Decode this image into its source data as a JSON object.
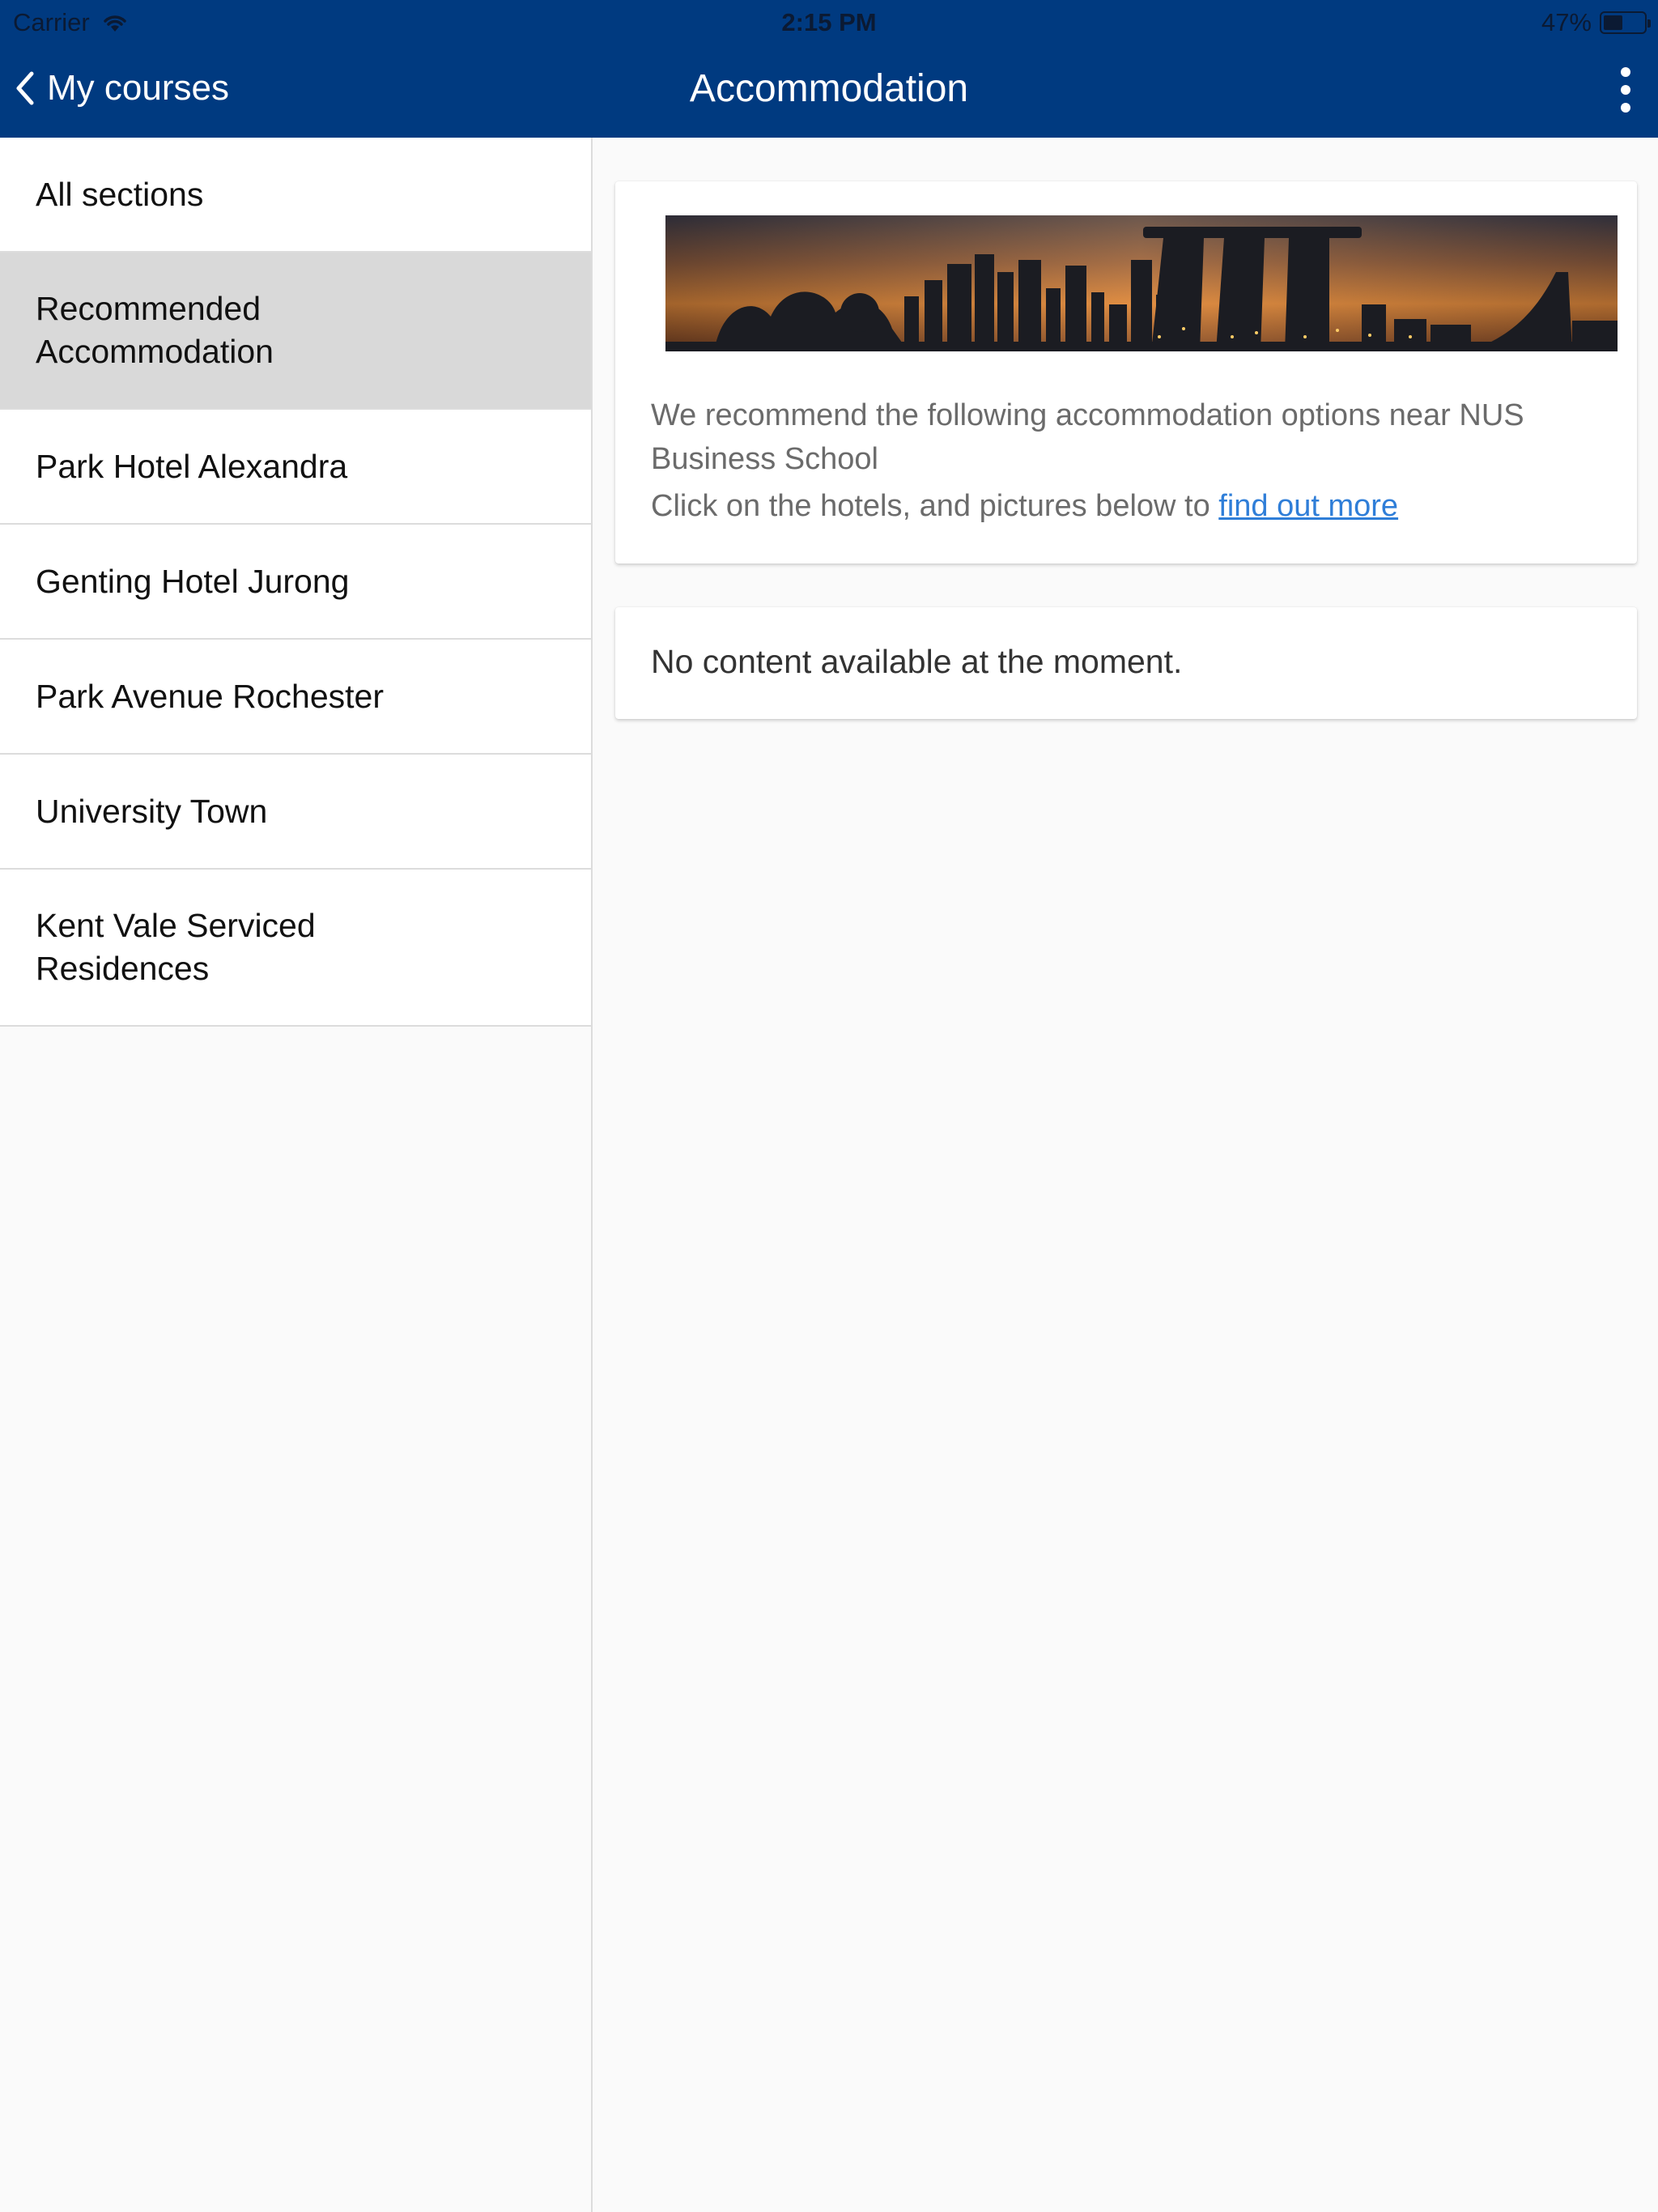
{
  "status_bar": {
    "carrier": "Carrier",
    "time": "2:15 PM",
    "battery_label": "47%",
    "battery_level": 0.47
  },
  "navbar": {
    "back_label": "My courses",
    "title": "Accommodation",
    "color": "#003a80"
  },
  "sidebar": {
    "items": [
      {
        "label": "All sections",
        "active": false
      },
      {
        "label": "Recommended Accommodation",
        "active": true
      },
      {
        "label": "Park Hotel Alexandra",
        "active": false
      },
      {
        "label": "Genting Hotel Jurong",
        "active": false
      },
      {
        "label": "Park Avenue Rochester",
        "active": false
      },
      {
        "label": "University Town",
        "active": false
      },
      {
        "label": "Kent Vale Serviced Residences",
        "active": false
      }
    ]
  },
  "content": {
    "intro_line1": "We recommend the following accommodation options near NUS Business School",
    "intro_line2_prefix": "Click on the hotels, and pictures below to ",
    "intro_link": "find out more",
    "empty_message": "No content available at the moment."
  },
  "icons": {
    "back": "chevron-left-icon",
    "more": "more-vertical-icon",
    "wifi": "wifi-icon",
    "battery": "battery-icon"
  }
}
